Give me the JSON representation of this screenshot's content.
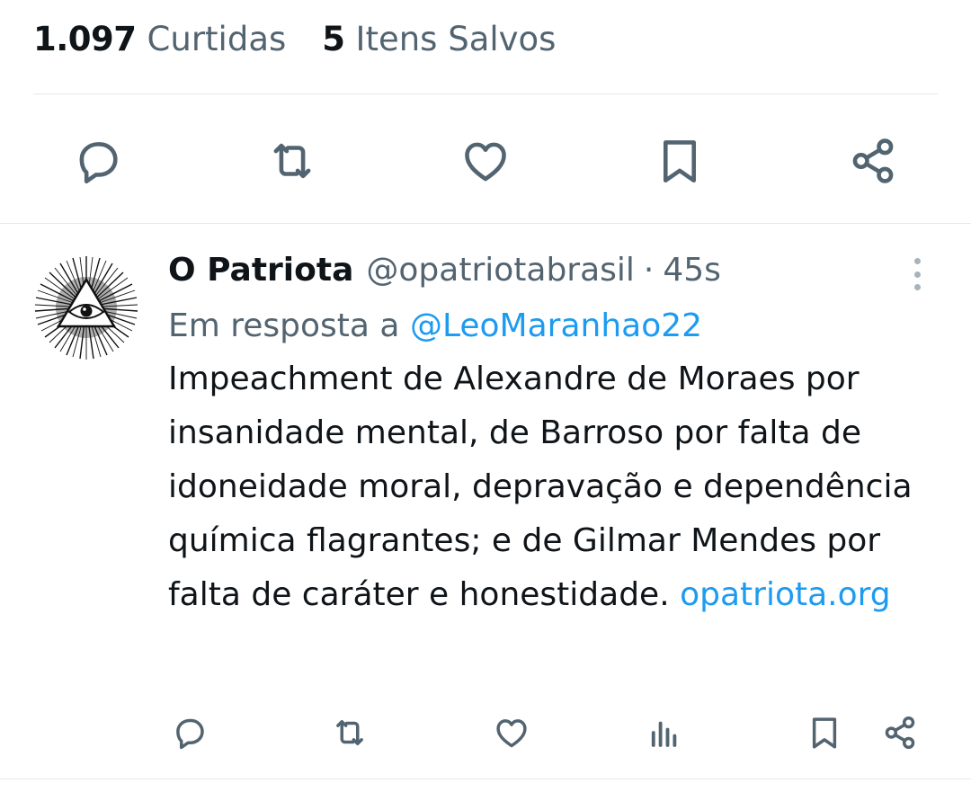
{
  "stats": {
    "likes_count": "1.097",
    "likes_label": "Curtidas",
    "saved_count": "5",
    "saved_label": "Itens Salvos"
  },
  "main_actions": {
    "icons": [
      "reply-icon",
      "retweet-icon",
      "like-icon",
      "bookmark-icon",
      "share-icon"
    ],
    "icon_color": "#536471"
  },
  "reply": {
    "author_name": "O Patriota",
    "handle": "@opatriotabrasil",
    "separator": "·",
    "time": "45s",
    "replying_prefix": "Em resposta a",
    "replying_to": "@LeoMaranhao22",
    "text": "Impeachment de Alexandre de Moraes por insanidade mental, de Barroso por falta de idoneidade moral, depravação e dependência química flagrantes; e de Gilmar Mendes por falta de caráter e honestidade.",
    "link": "opatriota.org",
    "actions": [
      "reply-icon",
      "retweet-icon",
      "like-icon",
      "views-icon",
      "bookmark-icon",
      "share-icon"
    ]
  },
  "colors": {
    "text": "#0f1419",
    "muted": "#536471",
    "link": "#1d9bf0",
    "divider": "#e4e8eb"
  }
}
